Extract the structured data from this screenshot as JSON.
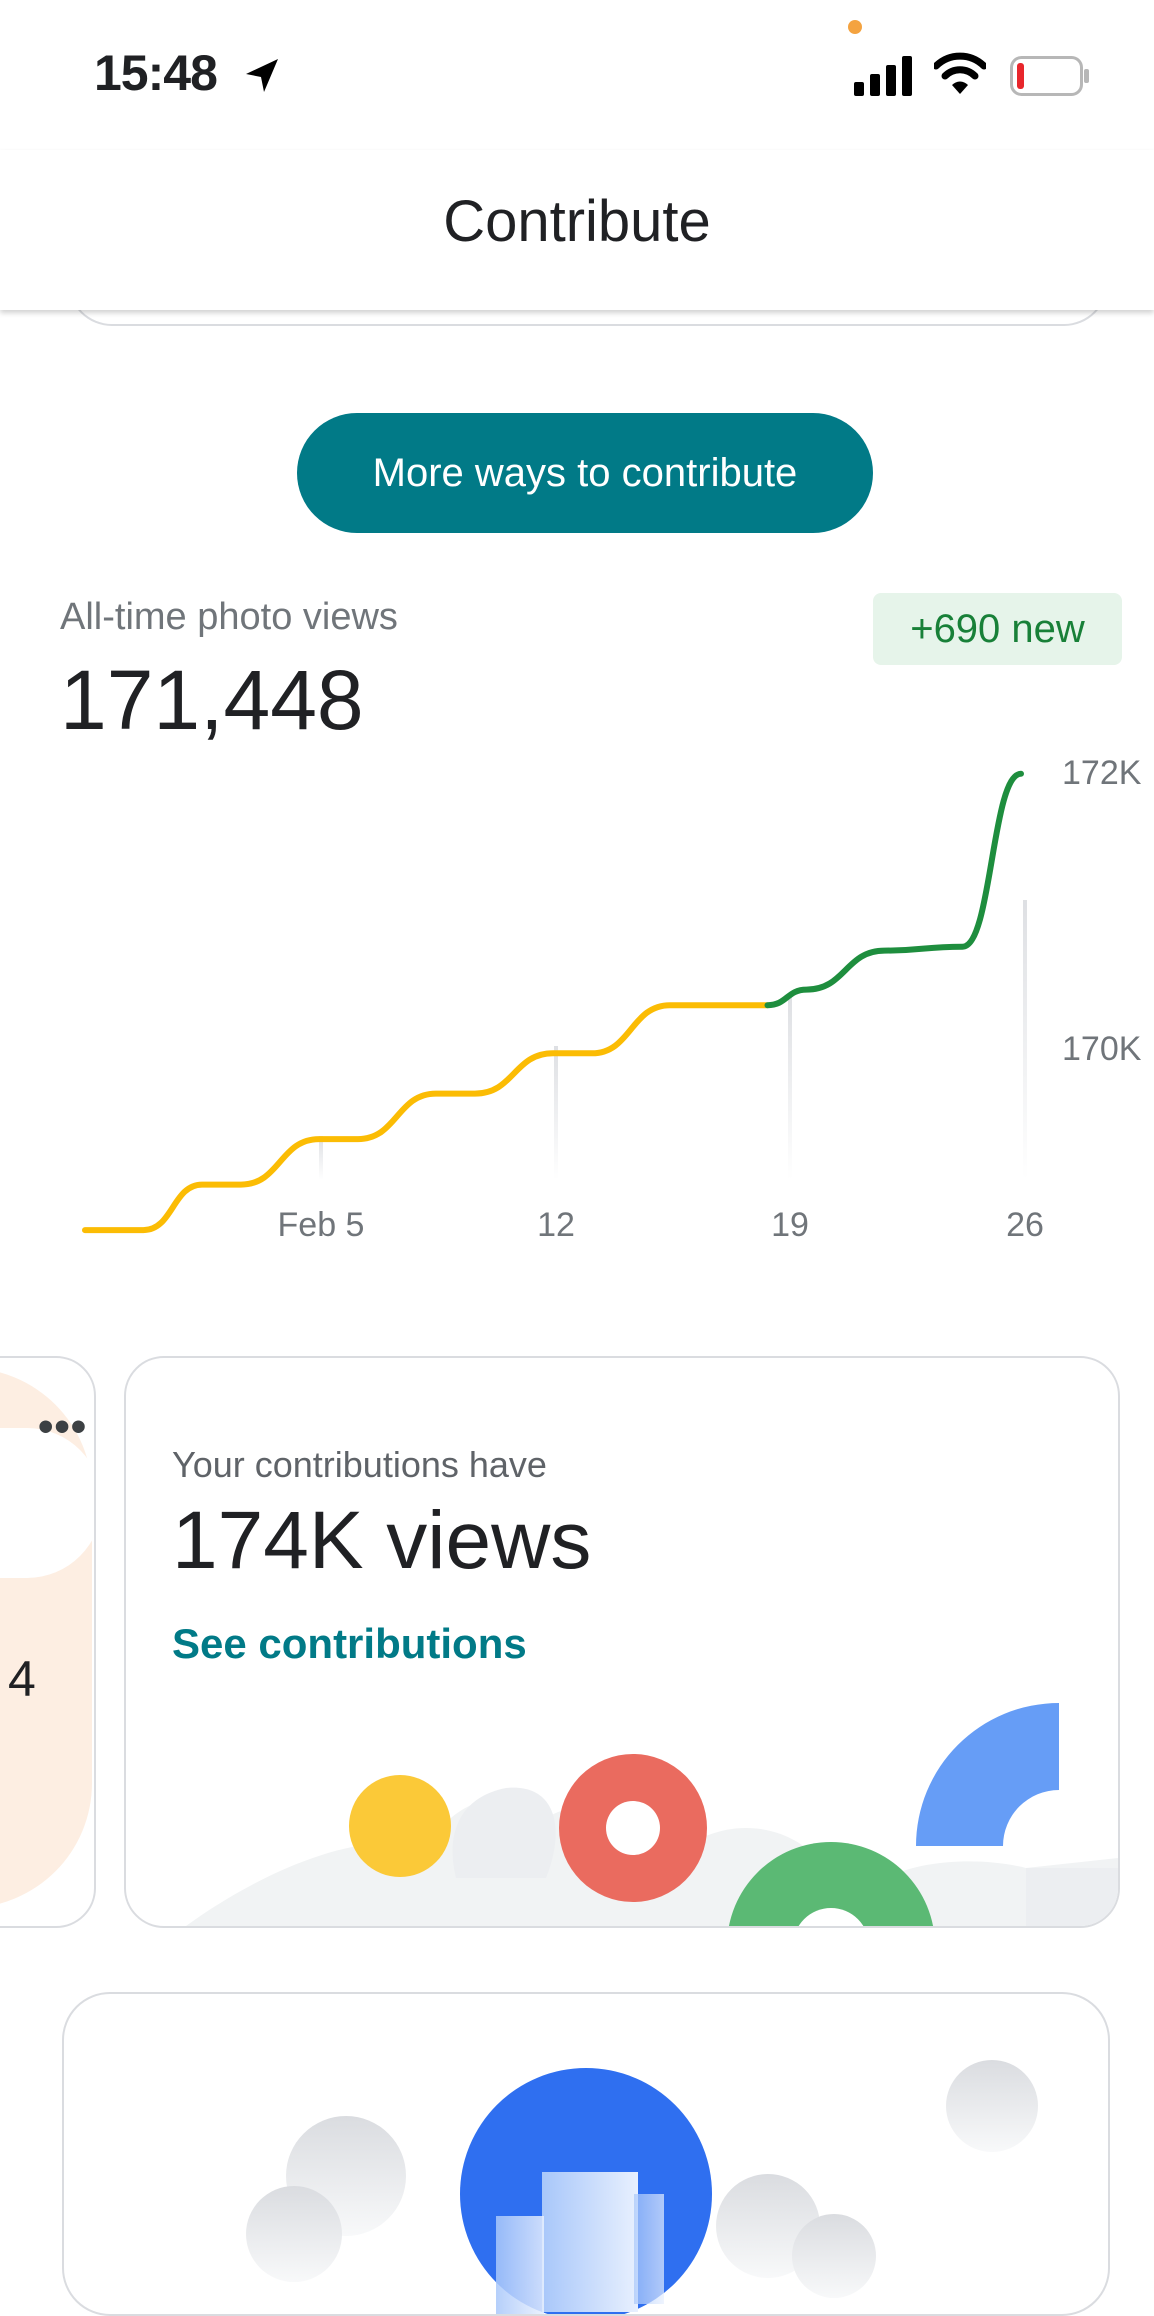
{
  "status_bar": {
    "time": "15:48",
    "icons": [
      "location-arrow-icon",
      "signal-icon",
      "wifi-icon",
      "battery-low-icon"
    ],
    "battery_level": 0.08
  },
  "header": {
    "title": "Contribute"
  },
  "cta": {
    "more_ways_label": "More ways to contribute"
  },
  "photo_views": {
    "label": "All-time photo views",
    "value": "171,448",
    "new_badge": "+690 new"
  },
  "chart_data": {
    "type": "line",
    "x_tick_labels": [
      "Feb 5",
      "12",
      "19",
      "26"
    ],
    "y_tick_labels": [
      "172K",
      "170K"
    ],
    "ylim": [
      168000,
      172000
    ],
    "series": [
      {
        "color": "#fbbc04",
        "x": [
          0,
          3,
          6,
          8,
          12,
          14,
          18,
          20,
          24,
          26,
          30,
          33,
          35
        ],
        "y": [
          168230,
          168230,
          168580,
          168580,
          168930,
          168930,
          169280,
          169280,
          169590,
          169590,
          169960,
          169960,
          169960
        ]
      },
      {
        "color": "#1e8e3e",
        "x": [
          35,
          37,
          41,
          45,
          48
        ],
        "y": [
          169960,
          170080,
          170380,
          170410,
          171740
        ]
      }
    ],
    "grid": false,
    "colors": {
      "previous": "#fbbc04",
      "recent": "#1e8e3e"
    }
  },
  "contributions_card": {
    "caption": "Your contributions have",
    "views": "174K views",
    "link": "See contributions"
  },
  "left_partial_card": {
    "menu": "•••",
    "number": "4"
  }
}
